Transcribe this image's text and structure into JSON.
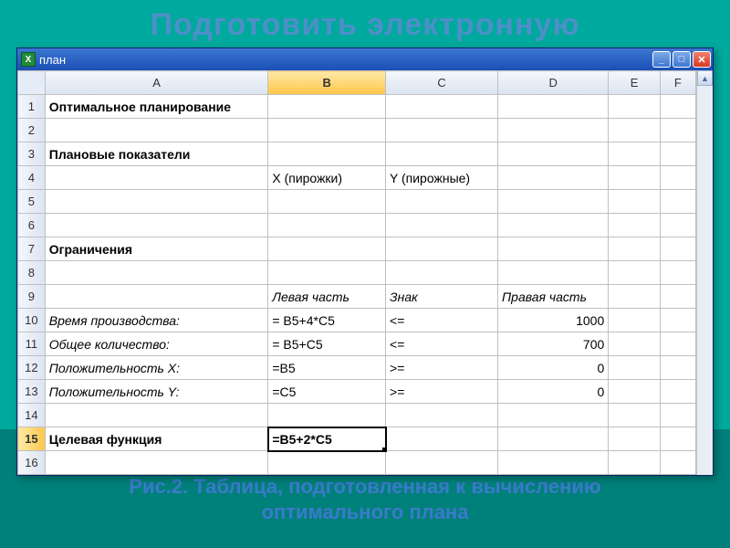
{
  "slide": {
    "top_text": "Подготовить электронную",
    "caption_line1": "Рис.2. Таблица, подготовленная к вычислению",
    "caption_line2": "оптимального плана"
  },
  "window": {
    "title": "план",
    "icon_letter": "X"
  },
  "columns": [
    "A",
    "B",
    "C",
    "D",
    "E",
    "F"
  ],
  "active_col": "B",
  "active_row": "15",
  "rows": [
    {
      "n": "1",
      "A": "Оптимальное планирование",
      "bold": true
    },
    {
      "n": "2"
    },
    {
      "n": "3",
      "A": "Плановые показатели",
      "bold": true
    },
    {
      "n": "4",
      "B": "X (пирожки)",
      "C": "Y (пирожные)"
    },
    {
      "n": "5"
    },
    {
      "n": "6"
    },
    {
      "n": "7",
      "A": "Ограничения",
      "bold": true
    },
    {
      "n": "8"
    },
    {
      "n": "9",
      "B": "Левая часть",
      "C": "Знак",
      "D": "Правая часть",
      "italic": true
    },
    {
      "n": "10",
      "A": "Время производства:",
      "B": " = B5+4*C5",
      "C": "<=",
      "D": "1000",
      "italicA": true,
      "rightD": true
    },
    {
      "n": "11",
      "A": "Общее количество:",
      "B": " = B5+C5",
      "C": "<=",
      "D": "700",
      "italicA": true,
      "rightD": true
    },
    {
      "n": "12",
      "A": "Положительность X:",
      "B": " =B5",
      "C": ">=",
      "D": "0",
      "italicA": true,
      "rightD": true
    },
    {
      "n": "13",
      "A": "Положительность Y:",
      "B": " =C5",
      "C": ">=",
      "D": "0",
      "italicA": true,
      "rightD": true
    },
    {
      "n": "14"
    },
    {
      "n": "15",
      "A": "Целевая функция",
      "B": "=B5+2*C5",
      "bold": true,
      "activeB": true
    },
    {
      "n": "16"
    }
  ],
  "chart_data": {
    "type": "table",
    "title": "Оптимальное планирование",
    "variables": {
      "X": "пирожки",
      "Y": "пирожные"
    },
    "constraints": [
      {
        "name": "Время производства",
        "lhs": "B5+4*C5",
        "op": "<=",
        "rhs": 1000
      },
      {
        "name": "Общее количество",
        "lhs": "B5+C5",
        "op": "<=",
        "rhs": 700
      },
      {
        "name": "Положительность X",
        "lhs": "B5",
        "op": ">=",
        "rhs": 0
      },
      {
        "name": "Положительность Y",
        "lhs": "C5",
        "op": ">=",
        "rhs": 0
      }
    ],
    "objective": {
      "name": "Целевая функция",
      "formula": "B5+2*C5"
    }
  }
}
